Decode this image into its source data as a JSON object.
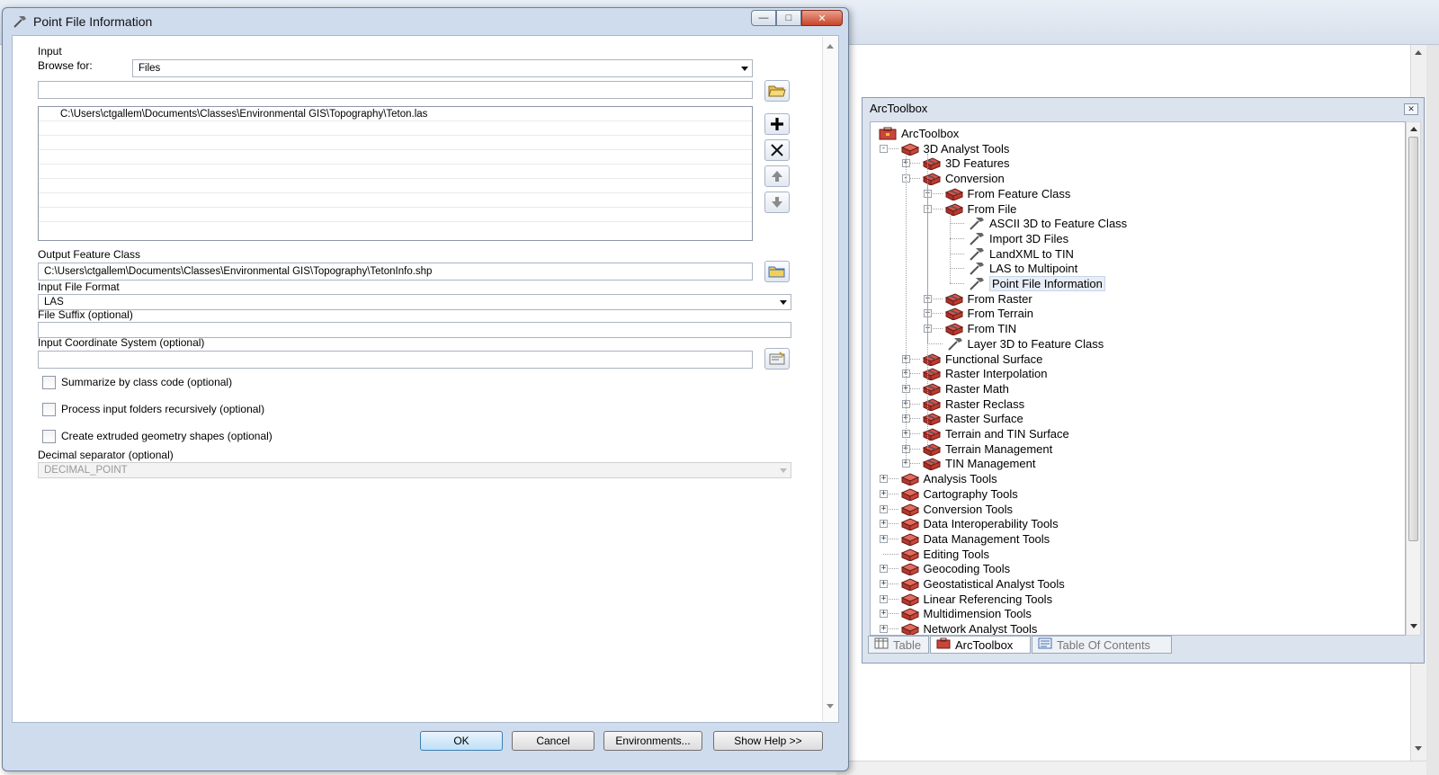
{
  "dialog": {
    "title": "Point File Information",
    "input_label": "Input",
    "browse_for_label": "Browse for:",
    "browse_for_value": "Files",
    "input_text_value": "",
    "input_files": [
      "C:\\Users\\ctgallem\\Documents\\Classes\\Environmental GIS\\Topography\\Teton.las"
    ],
    "output_feature_class_label": "Output Feature Class",
    "output_feature_class_value": "C:\\Users\\ctgallem\\Documents\\Classes\\Environmental GIS\\Topography\\TetonInfo.shp",
    "input_file_format_label": "Input File Format",
    "input_file_format_value": "LAS",
    "file_suffix_label": "File Suffix (optional)",
    "file_suffix_value": "",
    "input_coord_label": "Input Coordinate System (optional)",
    "input_coord_value": "",
    "checkboxes": [
      {
        "label": "Summarize by class code (optional)",
        "checked": false
      },
      {
        "label": "Process input folders recursively (optional)",
        "checked": false
      },
      {
        "label": "Create extruded geometry shapes (optional)",
        "checked": false
      }
    ],
    "decimal_separator_label": "Decimal separator (optional)",
    "decimal_separator_value": "DECIMAL_POINT",
    "buttons": {
      "ok": "OK",
      "cancel": "Cancel",
      "environments": "Environments...",
      "show_help": "Show Help >>"
    }
  },
  "toolbox": {
    "title": "ArcToolbox",
    "tree": [
      {
        "label": "ArcToolbox",
        "depth": 0,
        "icon": "toolbox-root-icon",
        "exp": ""
      },
      {
        "label": "3D Analyst Tools",
        "depth": 1,
        "icon": "toolbox-icon",
        "exp": "-"
      },
      {
        "label": "3D Features",
        "depth": 2,
        "icon": "toolset-icon",
        "exp": "+"
      },
      {
        "label": "Conversion",
        "depth": 2,
        "icon": "toolset-icon",
        "exp": "-"
      },
      {
        "label": "From Feature Class",
        "depth": 3,
        "icon": "toolset-icon",
        "exp": "+"
      },
      {
        "label": "From File",
        "depth": 3,
        "icon": "toolset-icon",
        "exp": "-"
      },
      {
        "label": "ASCII 3D to Feature Class",
        "depth": 4,
        "icon": "hammer-icon",
        "exp": ""
      },
      {
        "label": "Import 3D Files",
        "depth": 4,
        "icon": "hammer-icon",
        "exp": ""
      },
      {
        "label": "LandXML to TIN",
        "depth": 4,
        "icon": "hammer-icon",
        "exp": ""
      },
      {
        "label": "LAS to Multipoint",
        "depth": 4,
        "icon": "hammer-icon",
        "exp": ""
      },
      {
        "label": "Point File Information",
        "depth": 4,
        "icon": "hammer-icon",
        "exp": "",
        "selected": true
      },
      {
        "label": "From Raster",
        "depth": 3,
        "icon": "toolset-icon",
        "exp": "+"
      },
      {
        "label": "From Terrain",
        "depth": 3,
        "icon": "toolset-icon",
        "exp": "+"
      },
      {
        "label": "From TIN",
        "depth": 3,
        "icon": "toolset-icon",
        "exp": "+"
      },
      {
        "label": "Layer 3D to Feature Class",
        "depth": 3,
        "icon": "hammer-icon",
        "exp": ""
      },
      {
        "label": "Functional Surface",
        "depth": 2,
        "icon": "toolset-icon",
        "exp": "+"
      },
      {
        "label": "Raster Interpolation",
        "depth": 2,
        "icon": "toolset-icon",
        "exp": "+"
      },
      {
        "label": "Raster Math",
        "depth": 2,
        "icon": "toolset-icon",
        "exp": "+"
      },
      {
        "label": "Raster Reclass",
        "depth": 2,
        "icon": "toolset-icon",
        "exp": "+"
      },
      {
        "label": "Raster Surface",
        "depth": 2,
        "icon": "toolset-icon",
        "exp": "+"
      },
      {
        "label": "Terrain and TIN Surface",
        "depth": 2,
        "icon": "toolset-icon",
        "exp": "+"
      },
      {
        "label": "Terrain Management",
        "depth": 2,
        "icon": "toolset-icon",
        "exp": "+"
      },
      {
        "label": "TIN Management",
        "depth": 2,
        "icon": "toolset-icon",
        "exp": "+"
      },
      {
        "label": "Analysis Tools",
        "depth": 1,
        "icon": "toolbox-icon",
        "exp": "+"
      },
      {
        "label": "Cartography Tools",
        "depth": 1,
        "icon": "toolbox-icon",
        "exp": "+"
      },
      {
        "label": "Conversion Tools",
        "depth": 1,
        "icon": "toolbox-icon",
        "exp": "+"
      },
      {
        "label": "Data Interoperability Tools",
        "depth": 1,
        "icon": "toolbox-icon",
        "exp": "+"
      },
      {
        "label": "Data Management Tools",
        "depth": 1,
        "icon": "toolbox-icon",
        "exp": "+"
      },
      {
        "label": "Editing Tools",
        "depth": 1,
        "icon": "toolbox-icon",
        "exp": ""
      },
      {
        "label": "Geocoding Tools",
        "depth": 1,
        "icon": "toolbox-icon",
        "exp": "+"
      },
      {
        "label": "Geostatistical Analyst Tools",
        "depth": 1,
        "icon": "toolbox-icon",
        "exp": "+"
      },
      {
        "label": "Linear Referencing Tools",
        "depth": 1,
        "icon": "toolbox-icon",
        "exp": "+"
      },
      {
        "label": "Multidimension Tools",
        "depth": 1,
        "icon": "toolbox-icon",
        "exp": "+"
      },
      {
        "label": "Network Analyst Tools",
        "depth": 1,
        "icon": "toolbox-icon",
        "exp": "+"
      }
    ],
    "tabs": [
      {
        "label": "Table",
        "icon": "table-icon",
        "active": false
      },
      {
        "label": "ArcToolbox",
        "icon": "toolbox-icon",
        "active": true
      },
      {
        "label": "Table Of Contents",
        "icon": "toc-icon",
        "active": false
      }
    ]
  },
  "colors": {
    "dialog_frame": "#cfdcee",
    "toolbox_red": "#c0392b",
    "ok_button": "#bfe0f7"
  }
}
